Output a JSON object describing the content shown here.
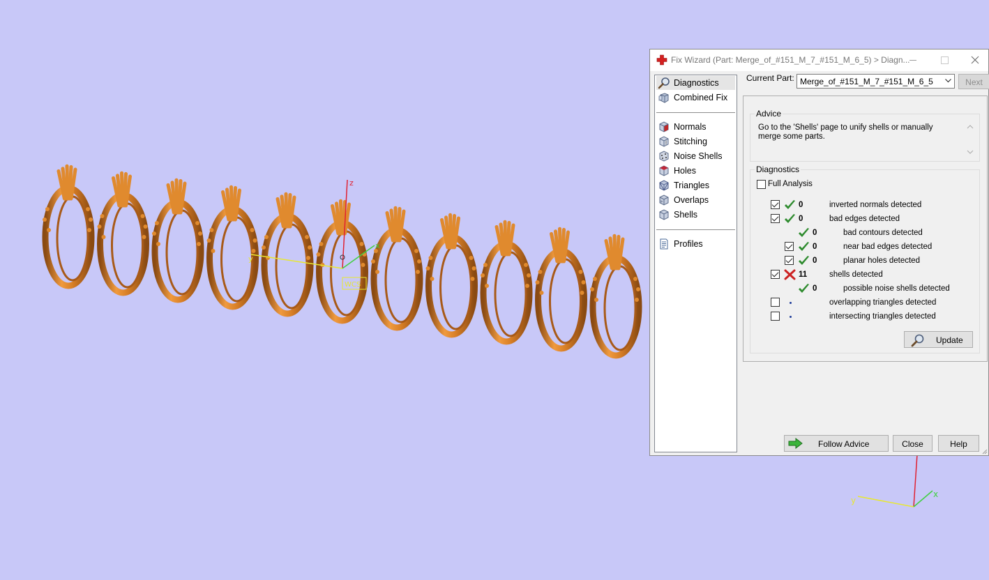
{
  "viewport": {
    "background": "#c8c8f8",
    "ring_color": "#e08a2e",
    "axes": {
      "x_label": "x",
      "y_label": "y",
      "z_label": "z"
    },
    "wcs_label": "WCS"
  },
  "dialog": {
    "title": "Fix Wizard (Part: Merge_of_#151_M_7_#151_M_6_5) > Diagn...",
    "nav": {
      "group1": [
        {
          "label": "Diagnostics",
          "icon": "magnifier-icon",
          "selected": true
        },
        {
          "label": "Combined Fix",
          "icon": "combined-fix-icon"
        }
      ],
      "group2": [
        {
          "label": "Normals",
          "icon": "normals-cube-icon"
        },
        {
          "label": "Stitching",
          "icon": "stitching-cube-icon"
        },
        {
          "label": "Noise Shells",
          "icon": "noise-shells-icon"
        },
        {
          "label": "Holes",
          "icon": "holes-cube-icon"
        },
        {
          "label": "Triangles",
          "icon": "triangles-cube-icon"
        },
        {
          "label": "Overlaps",
          "icon": "overlaps-cube-icon"
        },
        {
          "label": "Shells",
          "icon": "shells-cube-icon"
        }
      ],
      "group3": [
        {
          "label": "Profiles",
          "icon": "document-icon"
        }
      ]
    },
    "current_part_label": "Current Part:",
    "current_part_value": "Merge_of_#151_M_7_#151_M_6_5",
    "next_label": "Next",
    "advice": {
      "title": "Advice",
      "text": "Go to the 'Shells' page to unify shells or manually merge some parts."
    },
    "diagnostics": {
      "title": "Diagnostics",
      "full_analysis_label": "Full Analysis",
      "full_analysis_checked": false,
      "rows": [
        {
          "checkbox": true,
          "checked": true,
          "status": "ok",
          "count": "0",
          "label": "inverted normals detected",
          "indent": 0
        },
        {
          "checkbox": true,
          "checked": true,
          "status": "ok",
          "count": "0",
          "label": "bad edges detected",
          "indent": 0
        },
        {
          "checkbox": false,
          "checked": false,
          "status": "ok",
          "count": "0",
          "label": "bad contours detected",
          "indent": 1
        },
        {
          "checkbox": true,
          "checked": true,
          "status": "ok",
          "count": "0",
          "label": "near bad edges detected",
          "indent": 1
        },
        {
          "checkbox": true,
          "checked": true,
          "status": "ok",
          "count": "0",
          "label": "planar holes detected",
          "indent": 1
        },
        {
          "checkbox": true,
          "checked": true,
          "status": "error",
          "count": "11",
          "label": "shells detected",
          "indent": 0
        },
        {
          "checkbox": false,
          "checked": false,
          "status": "ok",
          "count": "0",
          "label": "possible noise shells detected",
          "indent": 1
        },
        {
          "checkbox": true,
          "checked": false,
          "status": "none",
          "count": "",
          "label": "overlapping triangles detected",
          "indent": 0
        },
        {
          "checkbox": true,
          "checked": false,
          "status": "none",
          "count": "",
          "label": "intersecting triangles detected",
          "indent": 0
        }
      ],
      "update_label": "Update"
    },
    "buttons": {
      "follow_advice": "Follow Advice",
      "close": "Close",
      "help": "Help"
    },
    "colors": {
      "ok": "#2e8b2e",
      "error": "#cc2222",
      "accent": "#3366cc"
    }
  }
}
